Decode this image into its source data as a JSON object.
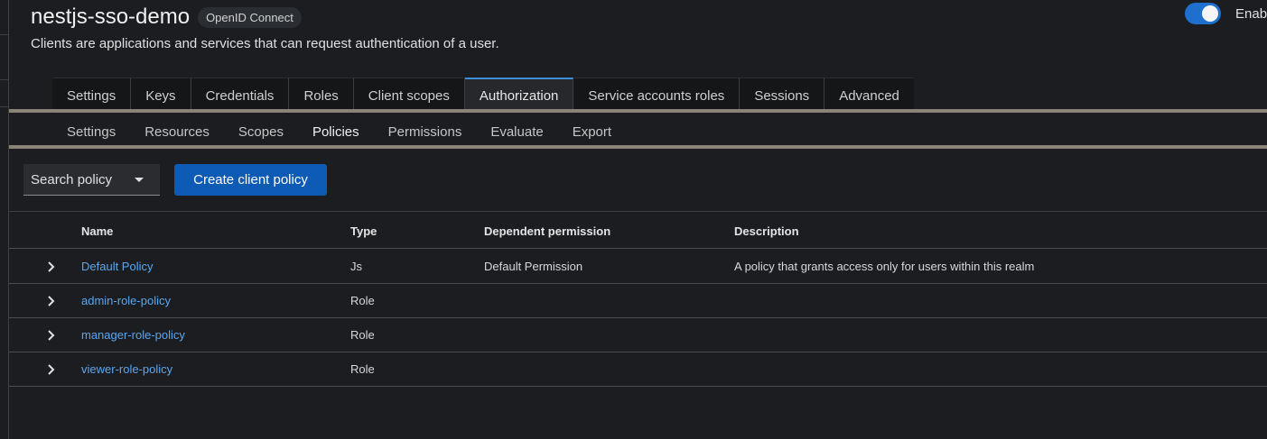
{
  "header": {
    "title": "nestjs-sso-demo",
    "protocol_badge": "OpenID Connect",
    "subtitle": "Clients are applications and services that can request authentication of a user.",
    "enabled_label": "Enab",
    "enabled": true
  },
  "tabs": [
    {
      "label": "Settings"
    },
    {
      "label": "Keys"
    },
    {
      "label": "Credentials"
    },
    {
      "label": "Roles"
    },
    {
      "label": "Client scopes"
    },
    {
      "label": "Authorization",
      "active": true
    },
    {
      "label": "Service accounts roles"
    },
    {
      "label": "Sessions"
    },
    {
      "label": "Advanced"
    }
  ],
  "subtabs": [
    {
      "label": "Settings"
    },
    {
      "label": "Resources"
    },
    {
      "label": "Scopes"
    },
    {
      "label": "Policies",
      "active": true
    },
    {
      "label": "Permissions"
    },
    {
      "label": "Evaluate"
    },
    {
      "label": "Export"
    }
  ],
  "toolbar": {
    "search_select_label": "Search policy",
    "create_button_label": "Create client policy"
  },
  "table": {
    "columns": [
      "Name",
      "Type",
      "Dependent permission",
      "Description"
    ],
    "rows": [
      {
        "name": "Default Policy",
        "type": "Js",
        "dependent_permission": "Default Permission",
        "description": "A policy that grants access only for users within this realm"
      },
      {
        "name": "admin-role-policy",
        "type": "Role",
        "dependent_permission": "",
        "description": ""
      },
      {
        "name": "manager-role-policy",
        "type": "Role",
        "dependent_permission": "",
        "description": ""
      },
      {
        "name": "viewer-role-policy",
        "type": "Role",
        "dependent_permission": "",
        "description": ""
      }
    ]
  },
  "icons": {
    "expand": "chevron-right-icon",
    "dropdown": "caret-down-icon"
  },
  "colors": {
    "accent": "#3d8ed8",
    "primary_button": "#0e5bb6",
    "link": "#5aa7f0",
    "toggle_on": "#1f6fcf"
  }
}
